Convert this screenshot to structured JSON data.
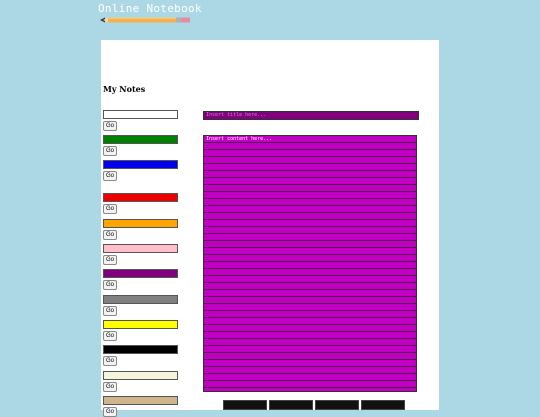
{
  "header": {
    "site_title": "Online Notebook",
    "logo_icon": "pencil-icon"
  },
  "sidebar": {
    "heading": "My Notes",
    "go_label": "Go",
    "swatches": [
      {
        "color": "#ffffff"
      },
      {
        "color": "#008000"
      },
      {
        "color": "#0000ee"
      },
      {
        "color": "#ee0000"
      },
      {
        "color": "#ffa500"
      },
      {
        "color": "#ffc0cb"
      },
      {
        "color": "#800080"
      },
      {
        "color": "#808080"
      },
      {
        "color": "#ffff00"
      },
      {
        "color": "#000000"
      },
      {
        "color": "#f5f5dc"
      },
      {
        "color": "#d2b48c"
      }
    ]
  },
  "editor": {
    "title_placeholder": "Insert title here...",
    "content_placeholder": "Insert content here...",
    "title_bg": "#800080",
    "content_bg": "#c000c0"
  },
  "toolbar": {
    "buttons": [
      {
        "label": ""
      },
      {
        "label": ""
      },
      {
        "label": ""
      },
      {
        "label": ""
      }
    ]
  }
}
